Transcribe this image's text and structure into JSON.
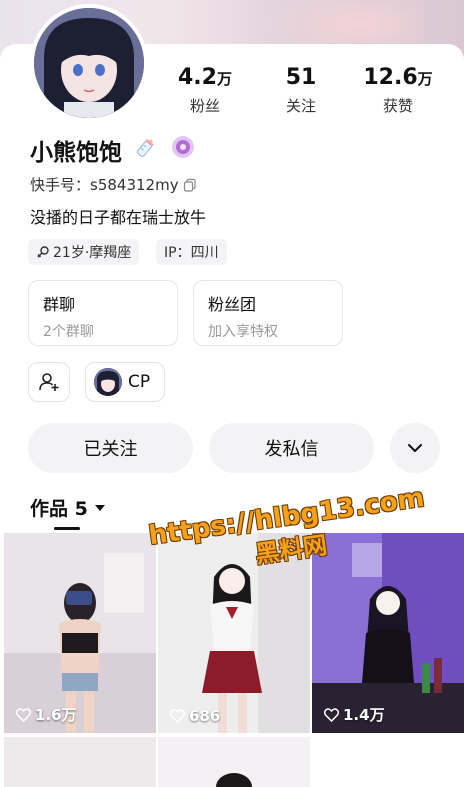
{
  "profile": {
    "name": "小熊饱饱",
    "kuaishou_id": "快手号：s584312my",
    "bio": "没播的日子都在瑞士放牛",
    "tags": [
      {
        "icon": "gender-icon",
        "label": "21岁·摩羯座"
      },
      {
        "icon": "",
        "label": "IP：四川"
      }
    ]
  },
  "stats": [
    {
      "value": "4.2",
      "unit": "万",
      "label": "粉丝"
    },
    {
      "value": "51",
      "unit": "",
      "label": "关注"
    },
    {
      "value": "12.6",
      "unit": "万",
      "label": "获赞"
    }
  ],
  "cards": [
    {
      "title": "群聊",
      "subtitle": "2个群聊"
    },
    {
      "title": "粉丝团",
      "subtitle": "加入享特权"
    }
  ],
  "cp_label": "CP",
  "actions": {
    "followed_label": "已关注",
    "message_label": "发私信"
  },
  "works": {
    "label": "作品 5",
    "items": [
      {
        "likes": "1.6万"
      },
      {
        "likes": "686"
      },
      {
        "likes": "1.4万"
      }
    ]
  },
  "watermark": {
    "url": "https://hlbg13.com",
    "text": "黑料网"
  },
  "colors": {
    "watermark": "#f7a11a",
    "badge": "#b36ad9"
  }
}
